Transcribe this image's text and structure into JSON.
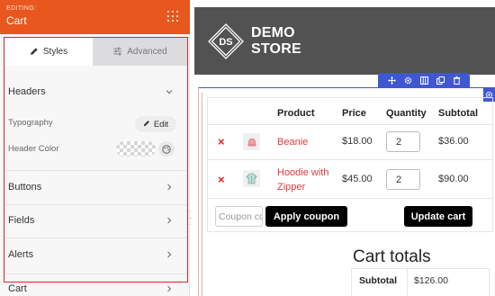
{
  "panel": {
    "editing_label": "EDITING:",
    "title": "Cart",
    "tabs": [
      {
        "label": "Styles",
        "icon": "pencil-icon",
        "active": true
      },
      {
        "label": "Advanced",
        "icon": "sliders-icon",
        "active": false
      }
    ],
    "sections": {
      "headers": "Headers",
      "typography_label": "Typography",
      "edit_label": "Edit",
      "header_color_label": "Header Color",
      "buttons": "Buttons",
      "fields": "Fields",
      "alerts": "Alerts",
      "cart": "Cart"
    },
    "colors": {
      "header_bg": "#e8571e",
      "highlight": "#e0202a"
    }
  },
  "store": {
    "logo_mark": "DS",
    "logo_line1": "DEMO",
    "logo_line2": "STORE"
  },
  "cart_table": {
    "headers": [
      "Product",
      "Price",
      "Quantity",
      "Subtotal"
    ],
    "rows": [
      {
        "product": "Beanie",
        "price": "$18.00",
        "quantity": "2",
        "subtotal": "$36.00"
      },
      {
        "product": "Hoodie with Zipper",
        "price": "$45.00",
        "quantity": "2",
        "subtotal": "$90.00"
      }
    ],
    "remove_symbol": "×",
    "coupon_placeholder": "Coupon code",
    "apply_coupon_label": "Apply coupon",
    "update_cart_label": "Update cart"
  },
  "cart_totals": {
    "title": "Cart totals",
    "subtotal_label": "Subtotal",
    "subtotal_value": "$126.00"
  },
  "toolbar_icons": [
    "move-icon",
    "settings-icon",
    "columns-icon",
    "duplicate-icon",
    "delete-icon"
  ],
  "colors": {
    "accent_blue": "#3f58d2",
    "link_red": "#e0393f",
    "remove_red": "#e02020"
  }
}
